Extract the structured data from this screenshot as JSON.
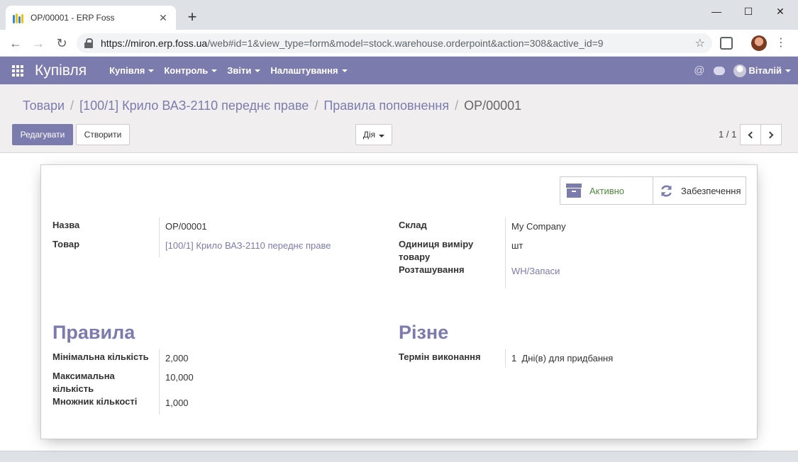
{
  "browser": {
    "tab_title": "OP/00001 - ERP Foss",
    "url_host": "https://miron.erp.foss.ua",
    "url_path": "/web#id=1&view_type=form&model=stock.warehouse.orderpoint&action=308&active_id=9"
  },
  "navbar": {
    "brand": "Купівля",
    "menu": [
      "Купівля",
      "Контроль",
      "Звіти",
      "Налаштування"
    ],
    "user": "Віталій"
  },
  "breadcrumb": [
    "Товари",
    "[100/1] Крило ВАЗ-2110 переднє праве",
    "Правила поповнення",
    "OP/00001"
  ],
  "buttons": {
    "edit": "Редагувати",
    "create": "Створити",
    "action": "Дія"
  },
  "pager": {
    "value": "1 / 1"
  },
  "smart_buttons": {
    "active": "Активно",
    "supply": "Забезпечення"
  },
  "form": {
    "name_label": "Назва",
    "name_value": "OP/00001",
    "product_label": "Товар",
    "product_value": "[100/1] Крило ВАЗ-2110 переднє праве",
    "warehouse_label": "Склад",
    "warehouse_value": "My Company",
    "uom_label_1": "Одиниця виміру",
    "uom_label_2": "товару",
    "uom_value": "шт",
    "location_label": "Розташування",
    "location_value": "WH/Запаси"
  },
  "rules": {
    "title": "Правила",
    "min_label": "Мінімальна кількість",
    "min_value": "2,000",
    "max_label_1": "Максимальна",
    "max_label_2": "кількість",
    "max_value": "10,000",
    "multiple_label": "Множник кількості",
    "multiple_value": "1,000"
  },
  "misc": {
    "title": "Різне",
    "lead_label": "Термін виконання",
    "lead_value": "1",
    "lead_unit": "Дні(в) для придбання"
  },
  "colors": {
    "primary": "#7c7bad",
    "active_green": "#4c8a3c"
  }
}
